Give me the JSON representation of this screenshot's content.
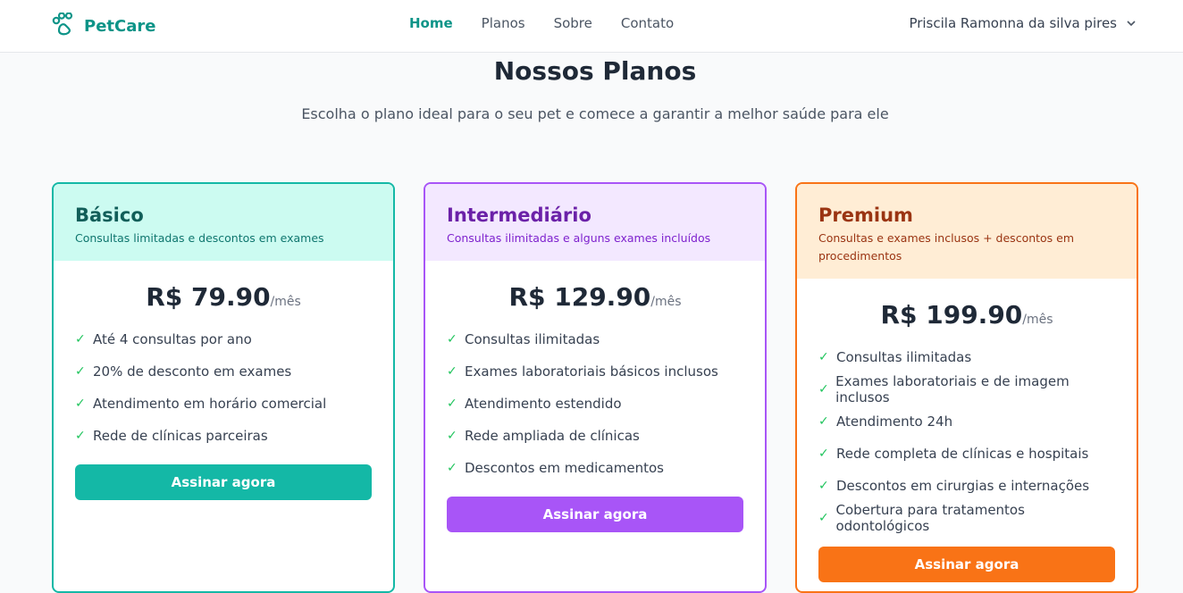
{
  "brand": {
    "name": "PetCare",
    "icon": "paw-icon",
    "color": "#0d9488"
  },
  "nav": {
    "links": [
      "Home",
      "Planos",
      "Sobre",
      "Contato"
    ],
    "active": "Home"
  },
  "user": {
    "name": "Priscila Ramonna da silva pires",
    "icon": "chevron-down-icon"
  },
  "page": {
    "title": "Nossos Planos",
    "subtitle": "Escolha o plano ideal para o seu pet e comece a garantir a melhor saúde para ele"
  },
  "plans": [
    {
      "name": "Básico",
      "description": "Consultas limitadas e descontos em exames",
      "price": "R$ 79.90",
      "period": "/mês",
      "features": [
        "Até 4 consultas por ano",
        "20% de desconto em exames",
        "Atendimento em horário comercial",
        "Rede de clínicas parceiras"
      ],
      "cta": "Assinar agora",
      "accent": "#14b8a6"
    },
    {
      "name": "Intermediário",
      "description": "Consultas ilimitadas e alguns exames incluídos",
      "price": "R$ 129.90",
      "period": "/mês",
      "features": [
        "Consultas ilimitadas",
        "Exames laboratoriais básicos inclusos",
        "Atendimento estendido",
        "Rede ampliada de clínicas",
        "Descontos em medicamentos"
      ],
      "cta": "Assinar agora",
      "accent": "#a855f7"
    },
    {
      "name": "Premium",
      "description": "Consultas e exames inclusos + descontos em procedimentos",
      "price": "R$ 199.90",
      "period": "/mês",
      "features": [
        "Consultas ilimitadas",
        "Exames laboratoriais e de imagem inclusos",
        "Atendimento 24h",
        "Rede completa de clínicas e hospitais",
        "Descontos em cirurgias e internações",
        "Cobertura para tratamentos odontológicos"
      ],
      "cta": "Assinar agora",
      "accent": "#f97316"
    }
  ],
  "check_icon": "✓"
}
